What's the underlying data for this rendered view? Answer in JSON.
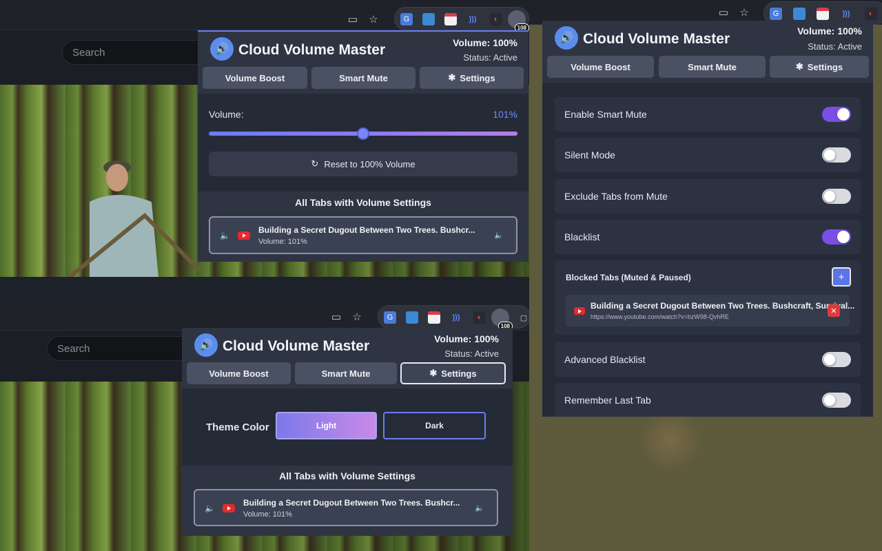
{
  "browser": {
    "search_placeholder": "Search",
    "extension_badge": "108"
  },
  "popup": {
    "title": "Cloud Volume Master",
    "volume_status": "Volume: 100%",
    "status": "Status: Active",
    "tabs": {
      "volume_boost": "Volume Boost",
      "smart_mute": "Smart Mute",
      "settings": "Settings"
    }
  },
  "volume_boost": {
    "volume_label": "Volume:",
    "volume_value": "101%",
    "slider_level": 0.5,
    "reset_label": "Reset to 100% Volume"
  },
  "tabs_list": {
    "heading": "All Tabs with Volume Settings",
    "items": [
      {
        "title": "Building a Secret Dugout Between Two Trees. Bushcr...",
        "volume": "Volume: 101%"
      }
    ]
  },
  "theme": {
    "label": "Theme Color",
    "light": "Light",
    "dark": "Dark"
  },
  "smart_mute": {
    "enable_smart_mute": "Enable Smart Mute",
    "silent_mode": "Silent Mode",
    "exclude_tabs": "Exclude Tabs from Mute",
    "blacklist": "Blacklist",
    "blocked_heading": "Blocked Tabs (Muted & Paused)",
    "add_symbol": "+",
    "blocked_items": [
      {
        "title": "Building a Secret Dugout Between Two Trees. Bushcraft, Survival...",
        "url": "https://www.youtube.com/watch?v=bzW98-QvhRE"
      }
    ],
    "advanced_blacklist": "Advanced Blacklist",
    "remember_last_tab": "Remember Last Tab"
  },
  "colors": {
    "accent": "#5b8def",
    "toggle_on": "#7b4fe6",
    "volume_value": "#6f8cff"
  }
}
